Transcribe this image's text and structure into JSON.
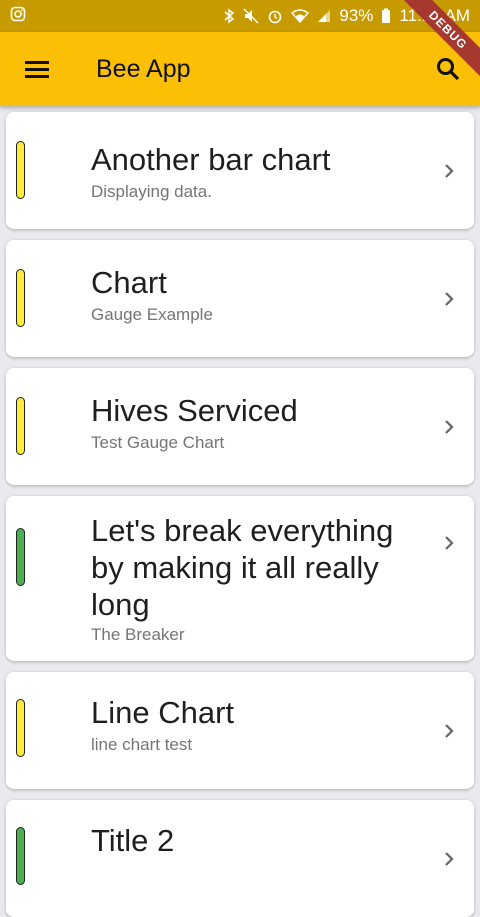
{
  "status_bar": {
    "battery": "93%",
    "time": "11:10 AM"
  },
  "app_bar": {
    "title": "Bee App",
    "debug_banner": "DEBUG"
  },
  "colors": {
    "app_bar": "#fbbf05",
    "status_bar": "#c79a00",
    "indicator_yellow": "#ffeb3b",
    "indicator_green": "#4caf50"
  },
  "list": {
    "items": [
      {
        "title": "Another bar chart",
        "subtitle": "Displaying data.",
        "status": "yellow"
      },
      {
        "title": "Chart",
        "subtitle": "Gauge Example",
        "status": "yellow"
      },
      {
        "title": "Hives Serviced",
        "subtitle": "Test Gauge Chart",
        "status": "yellow"
      },
      {
        "title": "Let's break everything by making it all really long",
        "subtitle": "The Breaker",
        "status": "green"
      },
      {
        "title": "Line Chart",
        "subtitle": "line chart test",
        "status": "yellow"
      },
      {
        "title": "Title 2",
        "subtitle": "",
        "status": "green"
      }
    ]
  }
}
